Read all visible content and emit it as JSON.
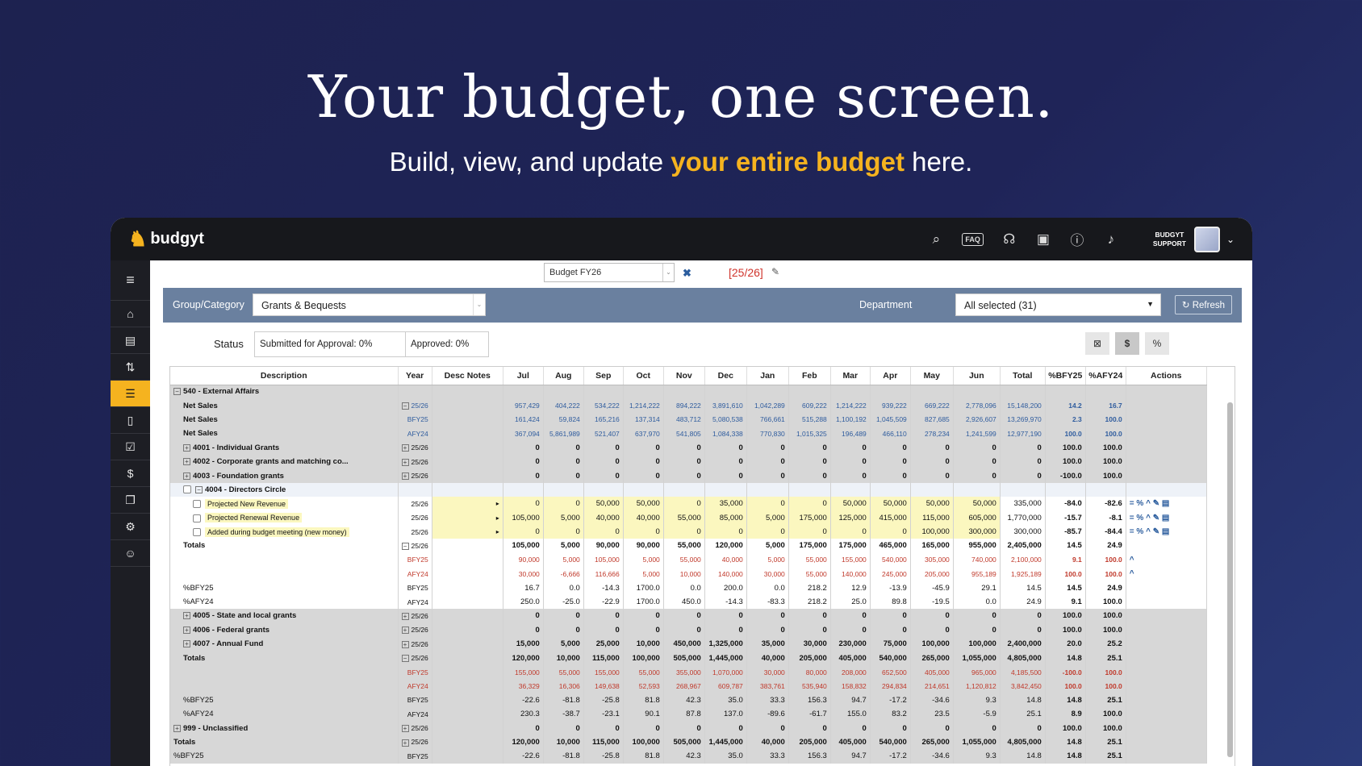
{
  "hero": {
    "title": "Your budget, one screen.",
    "subtitle_pre": "Build, view, and update ",
    "subtitle_highlight": "your entire budget",
    "subtitle_post": " here."
  },
  "app": {
    "logo_text": "budgyt",
    "faq_label": "FAQ",
    "support_line1": "BUDGYT",
    "support_line2": "SUPPORT"
  },
  "toolbar": {
    "budget_select": "Budget FY26",
    "period": "[25/26]"
  },
  "filters": {
    "group_label": "Group/Category",
    "group_value": "Grants & Bequests",
    "dept_label": "Department",
    "dept_value": "All selected (31)",
    "refresh_label": "Refresh"
  },
  "status": {
    "label": "Status",
    "submitted": "Submitted for Approval: 0%",
    "approved": "Approved: 0%",
    "dollar_label": "$",
    "percent_label": "%"
  },
  "grid": {
    "columns": [
      "Description",
      "Year",
      "Desc Notes",
      "Jul",
      "Aug",
      "Sep",
      "Oct",
      "Nov",
      "Dec",
      "Jan",
      "Feb",
      "Mar",
      "Apr",
      "May",
      "Jun",
      "Total",
      "%BFY25",
      "%AFY24",
      "Actions"
    ],
    "rows": [
      {
        "desc": "540 - External Affairs",
        "toggle": "−",
        "level": 0,
        "style": "gray",
        "year": "",
        "vals": [
          "",
          "",
          "",
          "",
          "",
          "",
          "",
          "",
          "",
          "",
          "",
          "",
          "",
          "",
          ""
        ]
      },
      {
        "desc": "Net Sales",
        "level": 1,
        "style": "gray blue",
        "ytog": "−",
        "year": "25/26",
        "vals": [
          "957,429",
          "404,222",
          "534,222",
          "1,214,222",
          "894,222",
          "3,891,610",
          "1,042,289",
          "609,222",
          "1,214,222",
          "939,222",
          "669,222",
          "2,778,096",
          "15,148,200",
          "14.2",
          "16.7"
        ]
      },
      {
        "desc": "Net Sales",
        "level": 1,
        "style": "gray blue",
        "year": "BFY25",
        "vals": [
          "161,424",
          "59,824",
          "165,216",
          "137,314",
          "483,712",
          "5,080,538",
          "766,661",
          "515,288",
          "1,100,192",
          "1,045,509",
          "827,685",
          "2,926,607",
          "13,269,970",
          "2.3",
          "100.0"
        ]
      },
      {
        "desc": "Net Sales",
        "level": 1,
        "style": "gray blue",
        "year": "AFY24",
        "vals": [
          "367,094",
          "5,861,989",
          "521,407",
          "637,970",
          "541,805",
          "1,084,338",
          "770,830",
          "1,015,325",
          "196,489",
          "466,110",
          "278,234",
          "1,241,599",
          "12,977,190",
          "100.0",
          "100.0"
        ]
      },
      {
        "desc": "4001 - Individual Grants",
        "toggle": "+",
        "level": 1,
        "style": "gray",
        "ytog": "+",
        "year": "25/26",
        "vals": [
          "0",
          "0",
          "0",
          "0",
          "0",
          "0",
          "0",
          "0",
          "0",
          "0",
          "0",
          "0",
          "0",
          "100.0",
          "100.0"
        ]
      },
      {
        "desc": "4002 - Corporate grants and matching co...",
        "toggle": "+",
        "level": 1,
        "style": "gray",
        "ytog": "+",
        "year": "25/26",
        "vals": [
          "0",
          "0",
          "0",
          "0",
          "0",
          "0",
          "0",
          "0",
          "0",
          "0",
          "0",
          "0",
          "0",
          "100.0",
          "100.0"
        ]
      },
      {
        "desc": "4003 - Foundation grants",
        "toggle": "+",
        "level": 1,
        "style": "gray",
        "ytog": "+",
        "year": "25/26",
        "vals": [
          "0",
          "0",
          "0",
          "0",
          "0",
          "0",
          "0",
          "0",
          "0",
          "0",
          "0",
          "0",
          "0",
          "-100.0",
          "100.0"
        ]
      },
      {
        "desc": "4004 - Directors Circle",
        "toggle": "−",
        "level": 1,
        "style": "lightblue",
        "checkbox": true,
        "year": "",
        "vals": [
          "",
          "",
          "",
          "",
          "",
          "",
          "",
          "",
          "",
          "",
          "",
          "",
          "",
          "",
          ""
        ]
      },
      {
        "desc": "Projected New Revenue",
        "level": 2,
        "style": "white edit",
        "checkbox": true,
        "year": "25/26",
        "vals": [
          "0",
          "0",
          "50,000",
          "50,000",
          "0",
          "35,000",
          "0",
          "0",
          "50,000",
          "50,000",
          "50,000",
          "50,000",
          "335,000",
          "-84.0",
          "-82.6"
        ],
        "actions": "= % ^ ✎ ▤"
      },
      {
        "desc": "Projected Renewal Revenue",
        "level": 2,
        "style": "white edit",
        "checkbox": true,
        "year": "25/26",
        "vals": [
          "105,000",
          "5,000",
          "40,000",
          "40,000",
          "55,000",
          "85,000",
          "5,000",
          "175,000",
          "125,000",
          "415,000",
          "115,000",
          "605,000",
          "1,770,000",
          "-15.7",
          "-8.1"
        ],
        "actions": "= % ^ ✎ ▤"
      },
      {
        "desc": "Added during budget meeting (new money)",
        "level": 2,
        "style": "white edit",
        "checkbox": true,
        "year": "25/26",
        "vals": [
          "0",
          "0",
          "0",
          "0",
          "0",
          "0",
          "0",
          "0",
          "0",
          "0",
          "100,000",
          "300,000",
          "300,000",
          "-85.7",
          "-84.4"
        ],
        "actions": "= % ^ ✎ ▤"
      },
      {
        "desc": "Totals",
        "level": 1,
        "style": "white bold",
        "ytog": "−",
        "year": "25/26",
        "vals": [
          "105,000",
          "5,000",
          "90,000",
          "90,000",
          "55,000",
          "120,000",
          "5,000",
          "175,000",
          "175,000",
          "465,000",
          "165,000",
          "955,000",
          "2,405,000",
          "14.5",
          "24.9"
        ]
      },
      {
        "desc": "",
        "level": 1,
        "style": "white red",
        "year": "BFY25",
        "vals": [
          "90,000",
          "5,000",
          "105,000",
          "5,000",
          "55,000",
          "40,000",
          "5,000",
          "55,000",
          "155,000",
          "540,000",
          "305,000",
          "740,000",
          "2,100,000",
          "9.1",
          "100.0"
        ],
        "actions": "^"
      },
      {
        "desc": "",
        "level": 1,
        "style": "white red",
        "year": "AFY24",
        "vals": [
          "30,000",
          "-6,666",
          "116,666",
          "5,000",
          "10,000",
          "140,000",
          "30,000",
          "55,000",
          "140,000",
          "245,000",
          "205,000",
          "955,189",
          "1,925,189",
          "100.0",
          "100.0"
        ],
        "actions": "^"
      },
      {
        "desc": "%BFY25",
        "level": 1,
        "style": "white plain",
        "year": "BFY25",
        "vals": [
          "16.7",
          "0.0",
          "-14.3",
          "1700.0",
          "0.0",
          "200.0",
          "0.0",
          "218.2",
          "12.9",
          "-13.9",
          "-45.9",
          "29.1",
          "14.5",
          "14.5",
          "24.9"
        ]
      },
      {
        "desc": "%AFY24",
        "level": 1,
        "style": "white plain",
        "year": "AFY24",
        "vals": [
          "250.0",
          "-25.0",
          "-22.9",
          "1700.0",
          "450.0",
          "-14.3",
          "-83.3",
          "218.2",
          "25.0",
          "89.8",
          "-19.5",
          "0.0",
          "24.9",
          "9.1",
          "100.0"
        ]
      },
      {
        "desc": "4005 - State and local grants",
        "toggle": "+",
        "level": 1,
        "style": "gray",
        "ytog": "+",
        "year": "25/26",
        "vals": [
          "0",
          "0",
          "0",
          "0",
          "0",
          "0",
          "0",
          "0",
          "0",
          "0",
          "0",
          "0",
          "0",
          "100.0",
          "100.0"
        ]
      },
      {
        "desc": "4006 - Federal grants",
        "toggle": "+",
        "level": 1,
        "style": "gray",
        "ytog": "+",
        "year": "25/26",
        "vals": [
          "0",
          "0",
          "0",
          "0",
          "0",
          "0",
          "0",
          "0",
          "0",
          "0",
          "0",
          "0",
          "0",
          "100.0",
          "100.0"
        ]
      },
      {
        "desc": "4007 - Annual Fund",
        "toggle": "+",
        "level": 1,
        "style": "gray",
        "ytog": "+",
        "year": "25/26",
        "vals": [
          "15,000",
          "5,000",
          "25,000",
          "10,000",
          "450,000",
          "1,325,000",
          "35,000",
          "30,000",
          "230,000",
          "75,000",
          "100,000",
          "100,000",
          "2,400,000",
          "20.0",
          "25.2"
        ]
      },
      {
        "desc": "Totals",
        "level": 1,
        "style": "gray",
        "ytog": "−",
        "year": "25/26",
        "vals": [
          "120,000",
          "10,000",
          "115,000",
          "100,000",
          "505,000",
          "1,445,000",
          "40,000",
          "205,000",
          "405,000",
          "540,000",
          "265,000",
          "1,055,000",
          "4,805,000",
          "14.8",
          "25.1"
        ]
      },
      {
        "desc": "",
        "level": 1,
        "style": "gray red",
        "year": "BFY25",
        "vals": [
          "155,000",
          "55,000",
          "155,000",
          "55,000",
          "355,000",
          "1,070,000",
          "30,000",
          "80,000",
          "208,000",
          "652,500",
          "405,000",
          "965,000",
          "4,185,500",
          "-100.0",
          "100.0"
        ]
      },
      {
        "desc": "",
        "level": 1,
        "style": "gray red",
        "year": "AFY24",
        "vals": [
          "36,329",
          "16,306",
          "149,638",
          "52,593",
          "268,967",
          "609,787",
          "383,761",
          "535,940",
          "158,832",
          "294,834",
          "214,651",
          "1,120,812",
          "3,842,450",
          "100.0",
          "100.0"
        ]
      },
      {
        "desc": "%BFY25",
        "level": 1,
        "style": "gray plain",
        "year": "BFY25",
        "vals": [
          "-22.6",
          "-81.8",
          "-25.8",
          "81.8",
          "42.3",
          "35.0",
          "33.3",
          "156.3",
          "94.7",
          "-17.2",
          "-34.6",
          "9.3",
          "14.8",
          "14.8",
          "25.1"
        ]
      },
      {
        "desc": "%AFY24",
        "level": 1,
        "style": "gray plain",
        "year": "AFY24",
        "vals": [
          "230.3",
          "-38.7",
          "-23.1",
          "90.1",
          "87.8",
          "137.0",
          "-89.6",
          "-61.7",
          "155.0",
          "83.2",
          "23.5",
          "-5.9",
          "25.1",
          "8.9",
          "100.0"
        ]
      },
      {
        "desc": "999 - Unclassified",
        "toggle": "+",
        "level": 0,
        "style": "gray",
        "ytog": "+",
        "year": "25/26",
        "vals": [
          "0",
          "0",
          "0",
          "0",
          "0",
          "0",
          "0",
          "0",
          "0",
          "0",
          "0",
          "0",
          "0",
          "100.0",
          "100.0"
        ]
      },
      {
        "desc": "Totals",
        "level": 0,
        "style": "gray",
        "ytog": "+",
        "year": "25/26",
        "vals": [
          "120,000",
          "10,000",
          "115,000",
          "100,000",
          "505,000",
          "1,445,000",
          "40,000",
          "205,000",
          "405,000",
          "540,000",
          "265,000",
          "1,055,000",
          "4,805,000",
          "14.8",
          "25.1"
        ]
      },
      {
        "desc": "%BFY25",
        "level": 0,
        "style": "gray plain",
        "year": "BFY25",
        "vals": [
          "-22.6",
          "-81.8",
          "-25.8",
          "81.8",
          "42.3",
          "35.0",
          "33.3",
          "156.3",
          "94.7",
          "-17.2",
          "-34.6",
          "9.3",
          "14.8",
          "14.8",
          "25.1"
        ]
      }
    ]
  },
  "colors": {
    "accent": "#f5b31f",
    "filter_bar": "#6a809f",
    "bg": "#1f2458"
  }
}
